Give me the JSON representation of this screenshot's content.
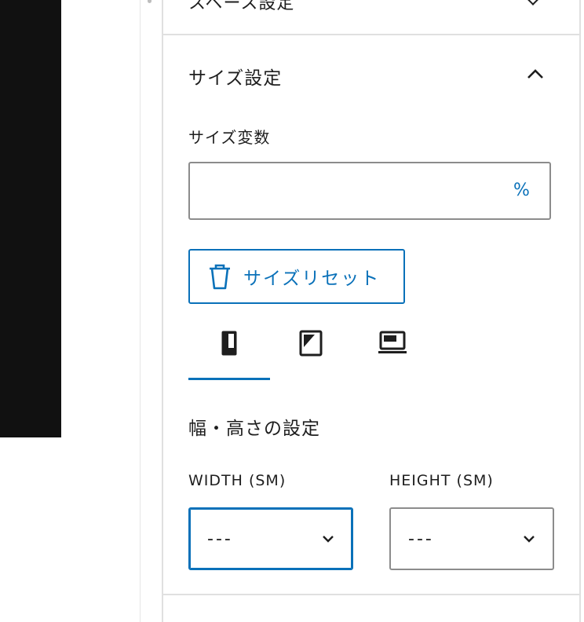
{
  "previous_panel": {
    "title": "スペース設定"
  },
  "panel": {
    "title": "サイズ設定",
    "size_variable": {
      "label": "サイズ変数",
      "value": "",
      "unit": "%"
    },
    "reset_button_label": "サイズリセット",
    "device_tabs": [
      {
        "icon": "mobile-icon",
        "selected": true
      },
      {
        "icon": "tablet-icon",
        "selected": false
      },
      {
        "icon": "laptop-icon",
        "selected": false
      }
    ],
    "dimensions": {
      "heading": "幅・高さの設定",
      "width": {
        "label": "WIDTH (SM)",
        "value": "---"
      },
      "height": {
        "label": "HEIGHT (SM)",
        "value": "---"
      }
    }
  },
  "colors": {
    "accent": "#0a71b9",
    "text": "#1e1e1e",
    "border": "#8c8c8c",
    "canvas_dark": "#111111"
  }
}
